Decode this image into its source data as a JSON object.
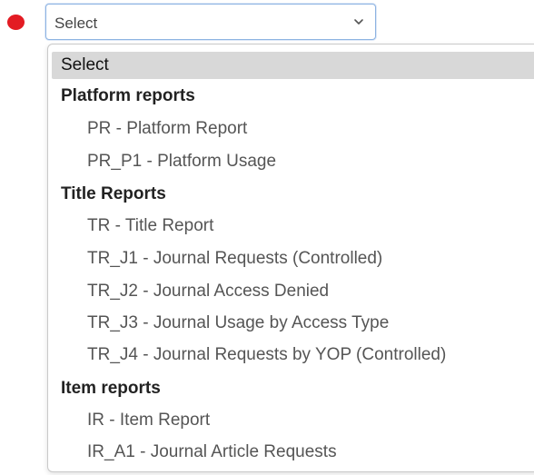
{
  "select": {
    "value": "Select"
  },
  "dropdown": {
    "selected_option": "Select",
    "groups": [
      {
        "label": "Platform reports",
        "options": [
          "PR - Platform Report",
          "PR_P1 - Platform Usage"
        ]
      },
      {
        "label": "Title Reports",
        "options": [
          "TR - Title Report",
          "TR_J1 - Journal Requests (Controlled)",
          "TR_J2 - Journal Access Denied",
          "TR_J3 - Journal Usage by Access Type",
          "TR_J4 - Journal Requests by YOP (Controlled)"
        ]
      },
      {
        "label": "Item reports",
        "options": [
          "IR - Item Report",
          "IR_A1 - Journal Article Requests"
        ]
      }
    ]
  },
  "colors": {
    "required_dot": "#e31b23",
    "select_border": "#8db3e2",
    "selected_option_bg": "#d8d8d8"
  }
}
